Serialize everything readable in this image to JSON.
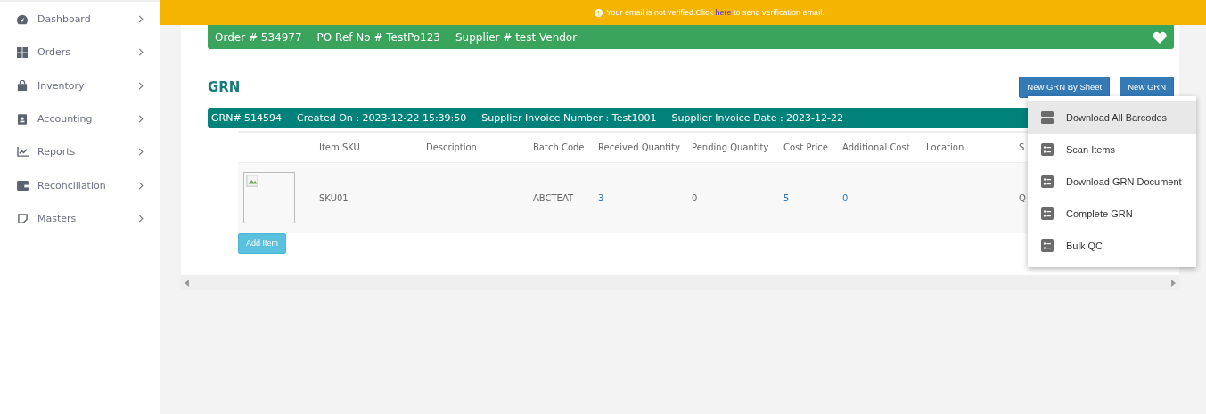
{
  "sidebar": {
    "items": [
      {
        "label": "Dashboard"
      },
      {
        "label": "Orders"
      },
      {
        "label": "Inventory"
      },
      {
        "label": "Accounting"
      },
      {
        "label": "Reports"
      },
      {
        "label": "Reconciliation"
      },
      {
        "label": "Masters"
      }
    ]
  },
  "banner": {
    "before": "Your email is not verified.Click",
    "link": "here",
    "after": "to send verification email."
  },
  "order_bar": [
    "Order # 534977",
    "PO Ref No # TestPo123",
    "Supplier # test Vendor"
  ],
  "section_title": "GRN",
  "buttons": [
    "New GRN By Sheet",
    "New GRN"
  ],
  "grn_bar": [
    "GRN# 514594",
    "Created On : 2023-12-22 15:39:50",
    "Supplier Invoice Number : Test1001",
    "Supplier Invoice Date : 2023-12-22"
  ],
  "table": {
    "columns": [
      "",
      "Item SKU",
      "Description",
      "Batch Code",
      "Received Quantity",
      "Pending Quantity",
      "Cost Price",
      "Additional Cost",
      "Location",
      "S"
    ],
    "rows": [
      {
        "cells": [
          {
            "kind": "image"
          },
          {
            "kind": "text",
            "text": "SKU01"
          },
          {
            "kind": "text",
            "text": ""
          },
          {
            "kind": "text",
            "text": "ABCTEAT"
          },
          {
            "kind": "link",
            "text": "3"
          },
          {
            "kind": "text",
            "text": "0"
          },
          {
            "kind": "link",
            "text": "5"
          },
          {
            "kind": "link",
            "text": "0"
          },
          {
            "kind": "text",
            "text": ""
          },
          {
            "kind": "text",
            "text": "Q"
          }
        ]
      }
    ]
  },
  "add_button": "Add Item",
  "menu": [
    {
      "label": "Download All Barcodes",
      "selected": true
    },
    {
      "label": "Scan Items",
      "selected": false
    },
    {
      "label": "Download GRN Document",
      "selected": false
    },
    {
      "label": "Complete GRN",
      "selected": false
    },
    {
      "label": "Bulk QC",
      "selected": false
    }
  ]
}
